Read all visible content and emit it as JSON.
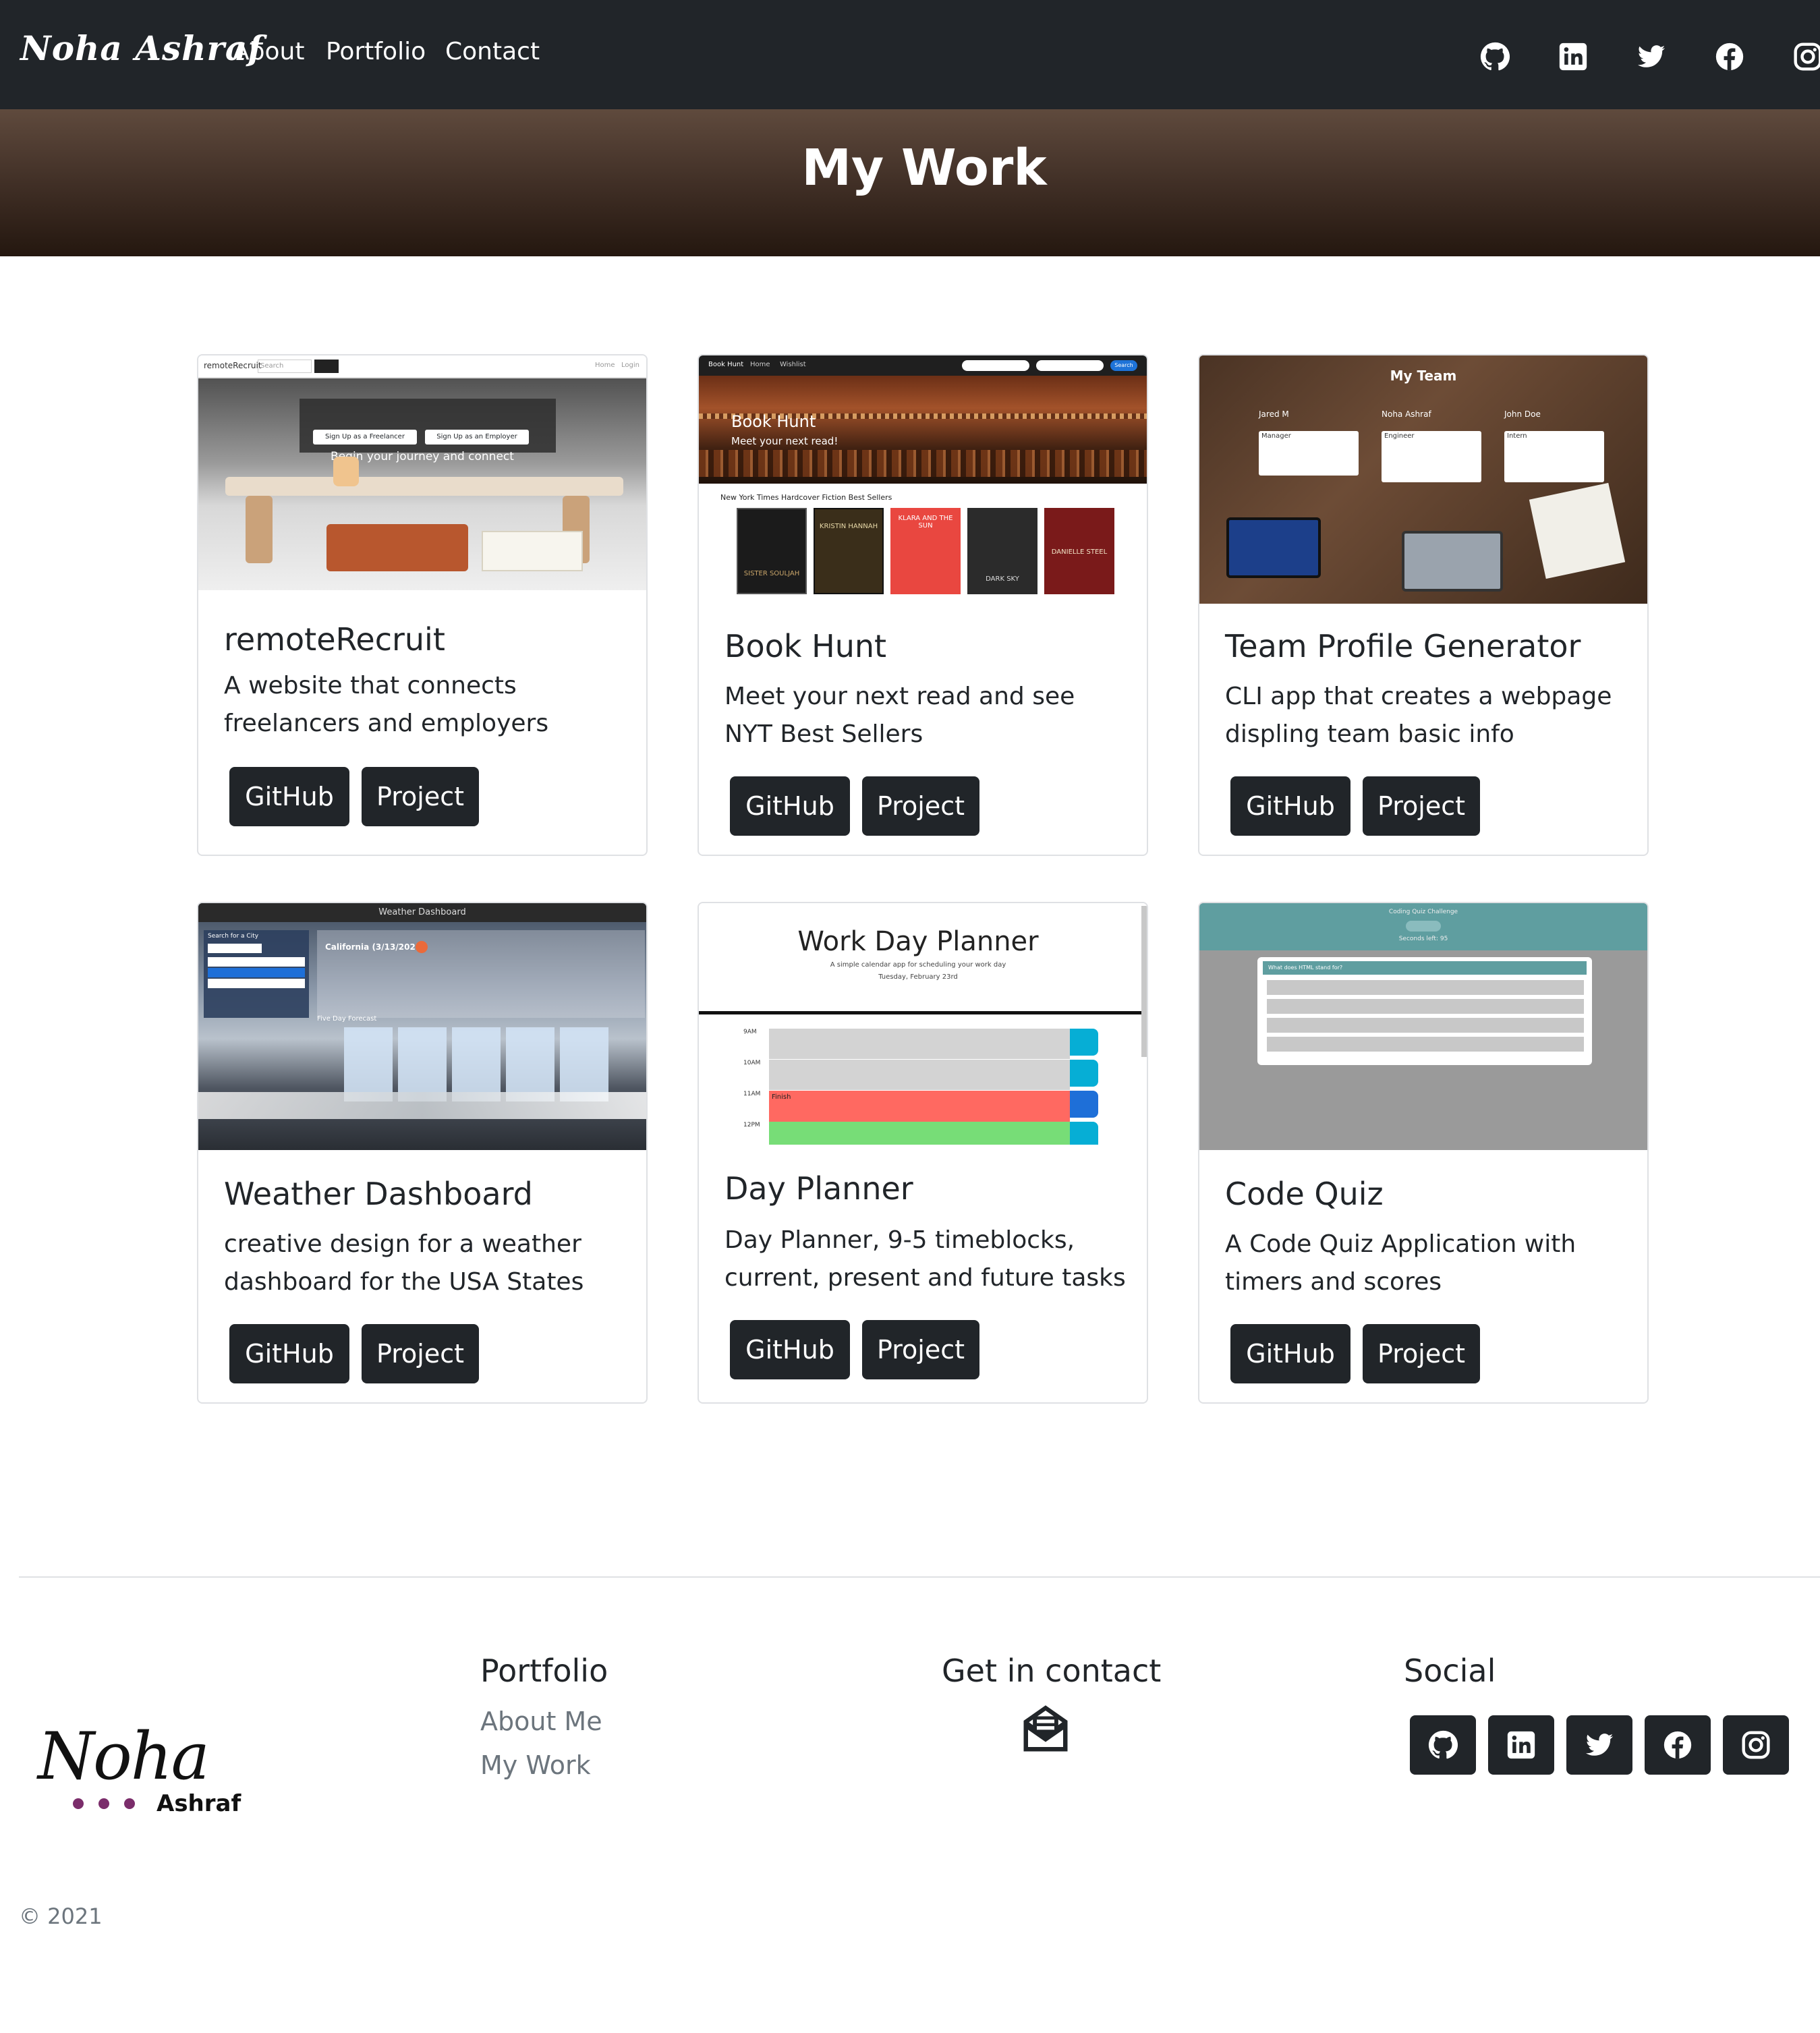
{
  "nav": {
    "brand": "Noha Ashraf",
    "links": [
      "About",
      "Portfolio",
      "Contact"
    ],
    "icons": [
      "github-icon",
      "linkedin-icon",
      "twitter-icon",
      "facebook-icon",
      "instagram-icon"
    ]
  },
  "hero": {
    "title": "My Work"
  },
  "projects": [
    {
      "title": "remoteRecruit",
      "description": "A website that connects freelancers and employers",
      "github_label": "GitHub",
      "project_label": "Project",
      "screenshot": {
        "nav_brand": "remoteRecruit",
        "nav_search": "Search",
        "nav_right": "Home   Login",
        "headline": "Begin your journey and connect",
        "button_freelancer": "Sign Up as a Freelancer",
        "button_employer": "Sign Up as an Employer"
      }
    },
    {
      "title": "Book Hunt",
      "description": "Meet your next read and see NYT Best Sellers",
      "github_label": "GitHub",
      "project_label": "Project",
      "screenshot": {
        "nav_items": [
          "Book Hunt",
          "Home",
          "Wishlist"
        ],
        "nav_button": "Search",
        "hero_title": "Book Hunt",
        "hero_subtitle": "Meet your next read!",
        "list_heading": "New York Times Hardcover Fiction Best Sellers",
        "books": [
          {
            "title": "SISTER SOULJAH",
            "color": "#1b1b1b"
          },
          {
            "title": "KRISTIN HANNAH",
            "color": "#3a2e1a"
          },
          {
            "title": "KLARA AND THE SUN",
            "color": "#e94740"
          },
          {
            "title": "DARK SKY",
            "color": "#2b2b2b"
          },
          {
            "title": "DANIELLE STEEL",
            "color": "#7a1a1a"
          }
        ]
      }
    },
    {
      "title": "Team Profile Generator",
      "description": "CLI app that creates a webpage displing team basic info",
      "github_label": "GitHub",
      "project_label": "Project",
      "screenshot": {
        "header": "My Team",
        "members": [
          {
            "name": "Jared M",
            "role": "Manager"
          },
          {
            "name": "Noha Ashraf",
            "role": "Engineer"
          },
          {
            "name": "John Doe",
            "role": "Intern"
          }
        ]
      }
    },
    {
      "title": "Weather Dashboard",
      "description": "creative design for a weather dashboard for the USA States",
      "github_label": "GitHub",
      "project_label": "Project",
      "screenshot": {
        "header": "Weather Dashboard",
        "search_label": "Search for a City",
        "current_city": "California (3/13/2021)",
        "forecast_title": "Five Day Forecast"
      }
    },
    {
      "title": "Day Planner",
      "description": "Day Planner, 9-5 timeblocks, current, present and future tasks",
      "github_label": "GitHub",
      "project_label": "Project",
      "screenshot": {
        "title": "Work Day Planner",
        "subtitle": "A simple calendar app for scheduling your work day",
        "date": "Tuesday, February 23rd",
        "hours": [
          "9AM",
          "10AM",
          "11AM",
          "12PM"
        ],
        "task": "Finish"
      }
    },
    {
      "title": "Code Quiz",
      "description": "A Code Quiz Application with timers and scores",
      "github_label": "GitHub",
      "project_label": "Project",
      "screenshot": {
        "header": "Coding Quiz Challenge",
        "timer": "Seconds left: 95",
        "question": "What does HTML stand for?"
      }
    }
  ],
  "footer": {
    "logo_text": "Noha",
    "logo_subtext": "Ashraf",
    "portfolio_heading": "Portfolio",
    "portfolio_links": [
      "About Me",
      "My Work"
    ],
    "contact_heading": "Get in contact",
    "social_heading": "Social",
    "copyright": "© 2021"
  },
  "colors": {
    "navbar": "#212529",
    "button": "#212529",
    "muted_text": "#6c757d",
    "logo_dots": "#7b2d6b"
  }
}
